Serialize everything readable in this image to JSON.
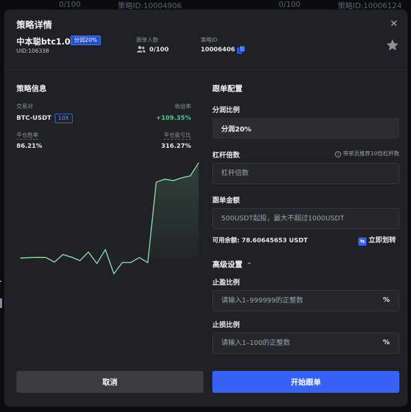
{
  "background": {
    "items": [
      "0/100",
      "策略ID:10004906",
      "0/100",
      "策略ID:10006124"
    ]
  },
  "modal": {
    "title": "策略详情",
    "close_icon": "close-icon"
  },
  "header": {
    "name": "中本聪btc1.0",
    "profit_share_badge": "分润20%",
    "uid": "UID:106338",
    "followers_label": "跟单人数",
    "followers_value": "0/100",
    "strategy_id_label": "策略ID",
    "strategy_id_value": "10006406"
  },
  "strategy_info": {
    "title": "策略信息",
    "pair_label": "交易对",
    "pair_value": "BTC-USDT",
    "leverage": "10X",
    "return_label": "收益率",
    "return_value": "+109.35%",
    "winrate_label": "平仓胜率",
    "winrate_value": "86.21%",
    "pnl_ratio_label": "平仓盈亏比",
    "pnl_ratio_value": "316.27%"
  },
  "chart_data": {
    "type": "area",
    "title": "",
    "xlabel": "",
    "ylabel": "",
    "values": [
      0,
      0.3,
      0.5,
      0.4,
      -3.8,
      3.2,
      0.8,
      -2.5,
      5.5,
      -5.1,
      7.8,
      -14.5,
      -4.2,
      -4.1,
      0.4,
      -4.3,
      69.8,
      72.5,
      71.2,
      73.8,
      75.5,
      87.5
    ],
    "color": "#8fe0a8"
  },
  "follow_config": {
    "title": "跟单配置",
    "share_label": "分润比例",
    "share_value": "分润20%",
    "leverage_label": "杠杆倍数",
    "leverage_hint": "带单员推荐10倍杠杆数",
    "leverage_placeholder": "杠杆倍数",
    "amount_label": "跟单金额",
    "amount_placeholder": "500USDT起投，最大不超过1000USDT",
    "balance_text": "可用余额: 78.60645653 USDT",
    "transfer_label": "立即划转",
    "advanced_label": "高级设置",
    "tp_label": "止盈比例",
    "tp_placeholder": "请输入1–999999的正整数",
    "tp_suffix": "%",
    "sl_label": "止损比例",
    "sl_placeholder": "请输入1–100的正整数",
    "sl_suffix": "%"
  },
  "footer": {
    "cancel_label": "取消",
    "start_label": "开始跟单"
  },
  "colors": {
    "accent": "#3762f5",
    "positive": "#52c88a",
    "modal_bg": "#1f2126"
  }
}
